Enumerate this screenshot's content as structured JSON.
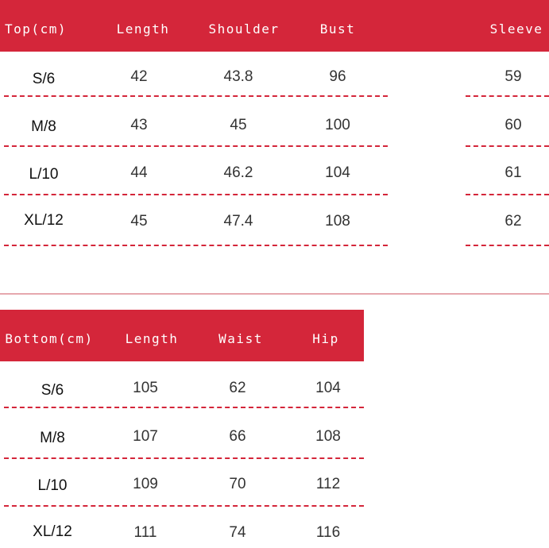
{
  "colors": {
    "header_bg": "#d4263a",
    "header_text": "#ffffff",
    "cell_text": "#333333",
    "divider": "#d4263a"
  },
  "top_table": {
    "headers": [
      "Top(cm)",
      "Length",
      "Shoulder",
      "Bust",
      "Sleeve"
    ],
    "rows": [
      [
        "S/6",
        "42",
        "43.8",
        "96",
        "59"
      ],
      [
        "M/8",
        "43",
        "45",
        "100",
        "60"
      ],
      [
        "L/10",
        "44",
        "46.2",
        "104",
        "61"
      ],
      [
        "XL/12",
        "45",
        "47.4",
        "108",
        "62"
      ]
    ]
  },
  "bottom_table": {
    "headers": [
      "Bottom(cm)",
      "Length",
      "Waist",
      "Hip"
    ],
    "rows": [
      [
        "S/6",
        "105",
        "62",
        "104"
      ],
      [
        "M/8",
        "107",
        "66",
        "108"
      ],
      [
        "L/10",
        "109",
        "70",
        "112"
      ],
      [
        "XL/12",
        "111",
        "74",
        "116"
      ]
    ]
  }
}
